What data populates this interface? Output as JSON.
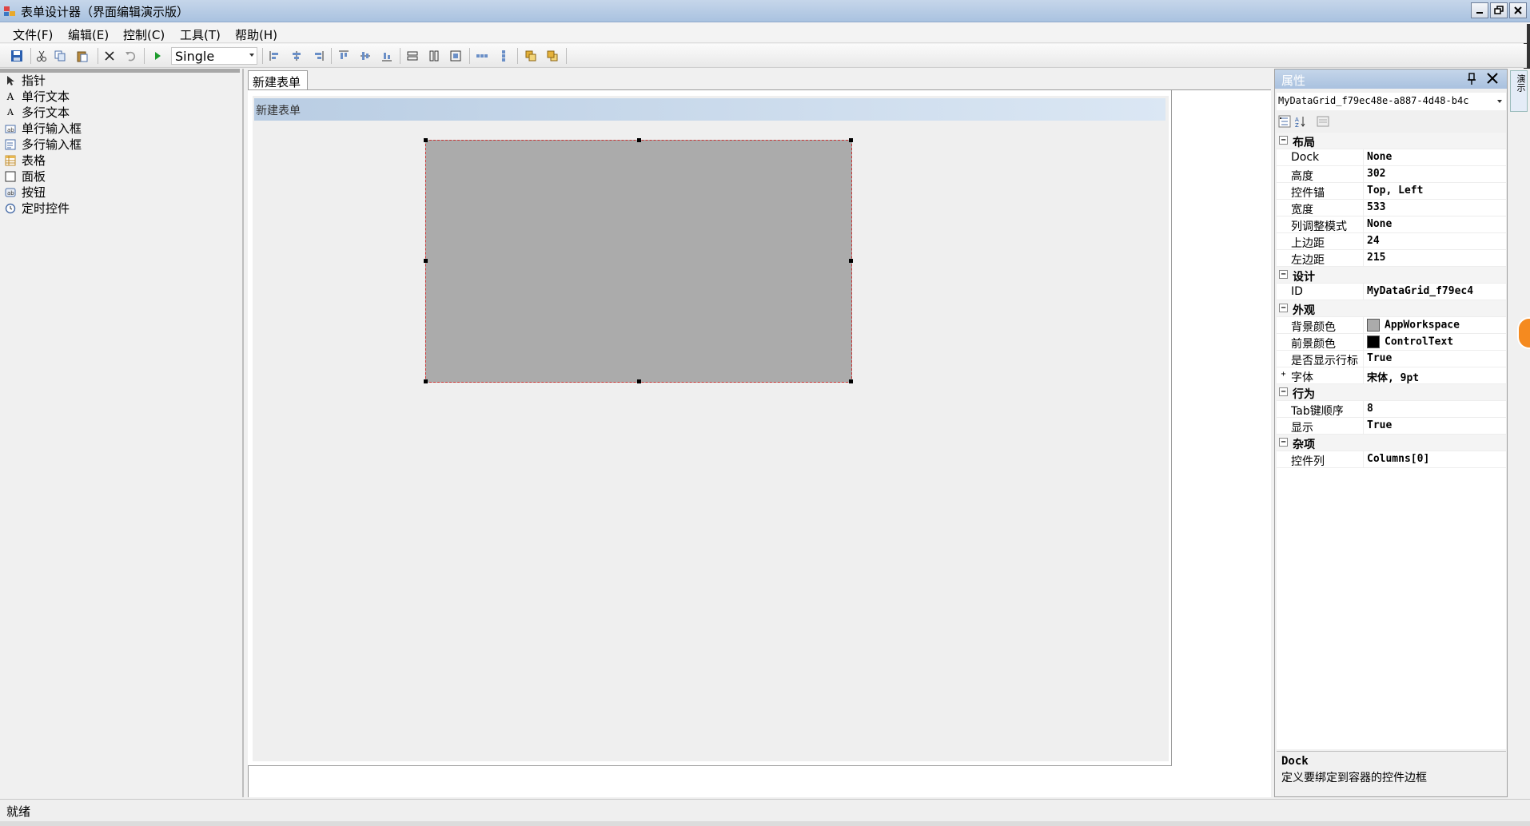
{
  "window": {
    "title": "表单设计器（界面编辑演示版）",
    "buttons": [
      "minimize",
      "restore",
      "close"
    ]
  },
  "menu": [
    {
      "label": "文件(F)"
    },
    {
      "label": "编辑(E)"
    },
    {
      "label": "控制(C)"
    },
    {
      "label": "工具(T)"
    },
    {
      "label": "帮助(H)"
    }
  ],
  "toolbar": {
    "zoom_value": "Single"
  },
  "toolbox": {
    "items": [
      {
        "label": "指针",
        "icon": "pointer-icon"
      },
      {
        "label": "单行文本",
        "icon": "label-icon"
      },
      {
        "label": "多行文本",
        "icon": "multiline-label-icon"
      },
      {
        "label": "单行输入框",
        "icon": "textbox-icon"
      },
      {
        "label": "多行输入框",
        "icon": "multiline-textbox-icon"
      },
      {
        "label": "表格",
        "icon": "grid-icon"
      },
      {
        "label": "面板",
        "icon": "panel-icon"
      },
      {
        "label": "按钮",
        "icon": "button-icon"
      },
      {
        "label": "定时控件",
        "icon": "timer-icon"
      }
    ]
  },
  "document": {
    "tab": "新建表单",
    "form_title": "新建表单"
  },
  "properties": {
    "title": "属性",
    "object": "MyDataGrid_f79ec48e-a887-4d48-b4c",
    "categories": [
      {
        "name": "布局",
        "expanded": true,
        "rows": [
          {
            "label": "Dock",
            "value": "None"
          },
          {
            "label": "高度",
            "value": "302"
          },
          {
            "label": "控件锚",
            "value": "Top, Left"
          },
          {
            "label": "宽度",
            "value": "533"
          },
          {
            "label": "列调整模式",
            "value": "None"
          },
          {
            "label": "上边距",
            "value": "24"
          },
          {
            "label": "左边距",
            "value": "215"
          }
        ]
      },
      {
        "name": "设计",
        "expanded": true,
        "rows": [
          {
            "label": "ID",
            "value": "MyDataGrid_f79ec4"
          }
        ]
      },
      {
        "name": "外观",
        "expanded": true,
        "rows": [
          {
            "label": "背景颜色",
            "value": "AppWorkspace",
            "swatch": "#ababab"
          },
          {
            "label": "前景颜色",
            "value": "ControlText",
            "swatch": "#000000"
          },
          {
            "label": "是否显示行标",
            "value": "True"
          },
          {
            "label": "字体",
            "value": "宋体, 9pt",
            "expandable": true
          }
        ]
      },
      {
        "name": "行为",
        "expanded": true,
        "rows": [
          {
            "label": "Tab键顺序",
            "value": "8"
          },
          {
            "label": "显示",
            "value": "True"
          }
        ]
      },
      {
        "name": "杂项",
        "expanded": true,
        "rows": [
          {
            "label": "控件列",
            "value": "Columns[0]"
          }
        ]
      }
    ],
    "description_title": "Dock",
    "description_text": "定义要绑定到容器的控件边框"
  },
  "sidetab": {
    "label": "演示"
  },
  "status": {
    "text": "就绪"
  }
}
